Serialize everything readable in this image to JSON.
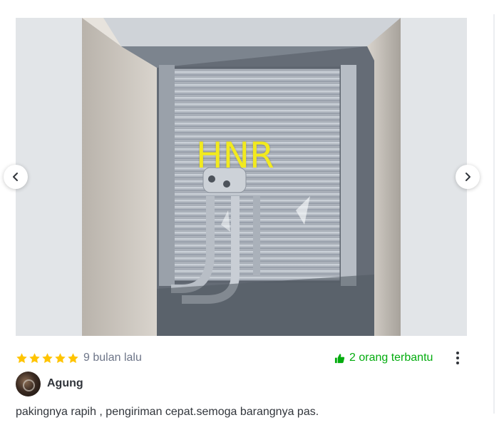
{
  "gallery": {
    "watermark": "HNR",
    "prev_icon": "chevron-left-icon",
    "next_icon": "chevron-right-icon"
  },
  "review": {
    "rating": 5,
    "rating_max": 5,
    "star_color": "#ffc400",
    "time_ago": "9 bulan lalu",
    "helpful_label": "2 orang terbantu",
    "helpful_icon": "thumbs-up-icon",
    "helpful_color": "#03ac0e",
    "more_icon": "more-vertical-icon",
    "reviewer_name": "Agung",
    "text": "pakingnya rapih , pengiriman cepat.semoga barangnya pas."
  }
}
